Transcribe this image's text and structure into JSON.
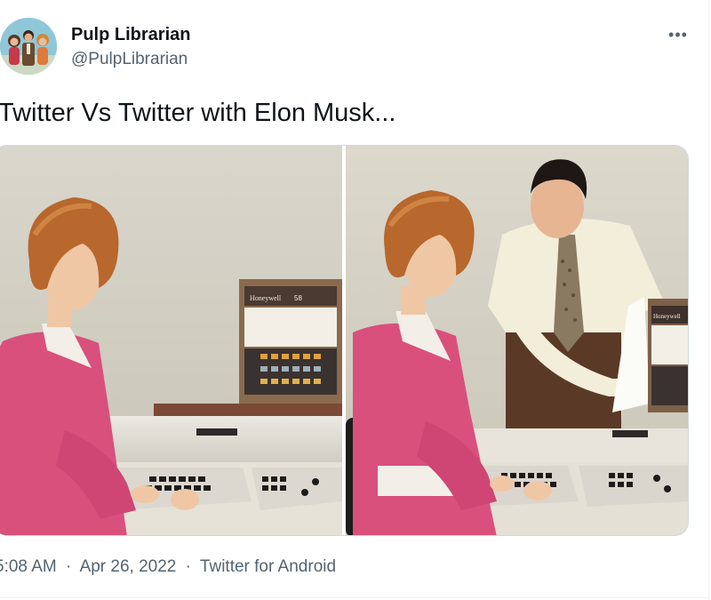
{
  "author": {
    "name": "Pulp Librarian",
    "handle": "@PulpLibrarian"
  },
  "more_icon": "•••",
  "tweet": {
    "text": "Twitter Vs Twitter with Elon Musk..."
  },
  "media": {
    "left_photo_logo": "Honeywell",
    "left_photo_model": "58",
    "right_photo_logo": "Honeywell"
  },
  "meta": {
    "time": "5:08 AM",
    "date": "Apr 26, 2022",
    "source": "Twitter for Android",
    "separator": "·"
  },
  "colors": {
    "text": "#0f1419",
    "secondary": "#536471",
    "border": "#cfd9de",
    "sweater": "#d9507d",
    "hair": "#b8672d"
  }
}
